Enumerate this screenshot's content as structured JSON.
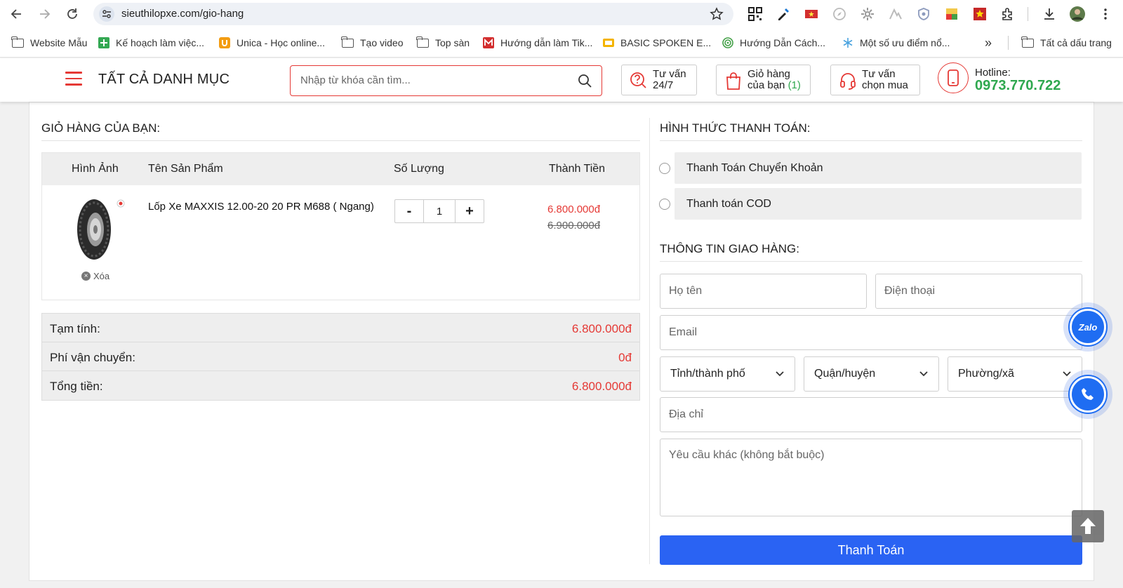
{
  "browser": {
    "url": "sieuthilopxe.com/gio-hang",
    "bookmarks": [
      "Website Mẫu",
      "Kế hoạch làm việc...",
      "Unica - Học online...",
      "Tạo video",
      "Top sàn",
      "Hướng dẫn làm Tik...",
      "BASIC SPOKEN E...",
      "Hướng Dẫn Cách...",
      "Một số ưu điểm nổ...",
      "Tất cả dấu trang"
    ],
    "overflow_label": "»"
  },
  "header": {
    "menu_label": "TẤT CẢ DANH MỤC",
    "search_placeholder": "Nhập từ khóa cần tìm...",
    "advice_line1": "Tư vấn",
    "advice_line2": "24/7",
    "cart_line1": "Giỏ hàng",
    "cart_line2": "của bạn",
    "cart_count": "(1)",
    "choose_line1": "Tư vấn",
    "choose_line2": "chọn mua",
    "hotline_label": "Hotline:",
    "hotline_number": "0973.770.722",
    "accent_color": "#e53935",
    "green_color": "#2fa84f"
  },
  "cart": {
    "title": "GIỎ HÀNG CỦA BẠN:",
    "columns": [
      "Hình Ảnh",
      "Tên Sản Phẩm",
      "Số Lượng",
      "Thành Tiền"
    ],
    "item": {
      "name": "Lốp Xe MAXXIS 12.00-20 20 PR M688 ( Ngang)",
      "remove_label": "Xóa",
      "qty_minus": "-",
      "quantity": "1",
      "qty_plus": "+",
      "price": "6.800.000đ",
      "old_price": "6.900.000đ"
    },
    "totals": [
      {
        "label": "Tạm tính:",
        "value": "6.800.000đ"
      },
      {
        "label": "Phí vận chuyển:",
        "value": "0đ"
      },
      {
        "label": "Tổng tiền:",
        "value": "6.800.000đ"
      }
    ]
  },
  "payment": {
    "title": "HÌNH THỨC THANH TOÁN:",
    "options": [
      "Thanh Toán Chuyển Khoản",
      "Thanh toán COD"
    ]
  },
  "shipping": {
    "title": "THÔNG TIN GIAO HÀNG:",
    "name_placeholder": "Họ tên",
    "phone_placeholder": "Điện thoại",
    "email_placeholder": "Email",
    "province": "Tỉnh/thành phố",
    "district": "Quận/huyện",
    "ward": "Phường/xã",
    "address_placeholder": "Địa chỉ",
    "note_placeholder": "Yêu cầu khác (không bắt buộc)",
    "submit_label": "Thanh Toán",
    "submit_color": "#2a63f3"
  },
  "floating": {
    "zalo_label": "Zalo"
  }
}
